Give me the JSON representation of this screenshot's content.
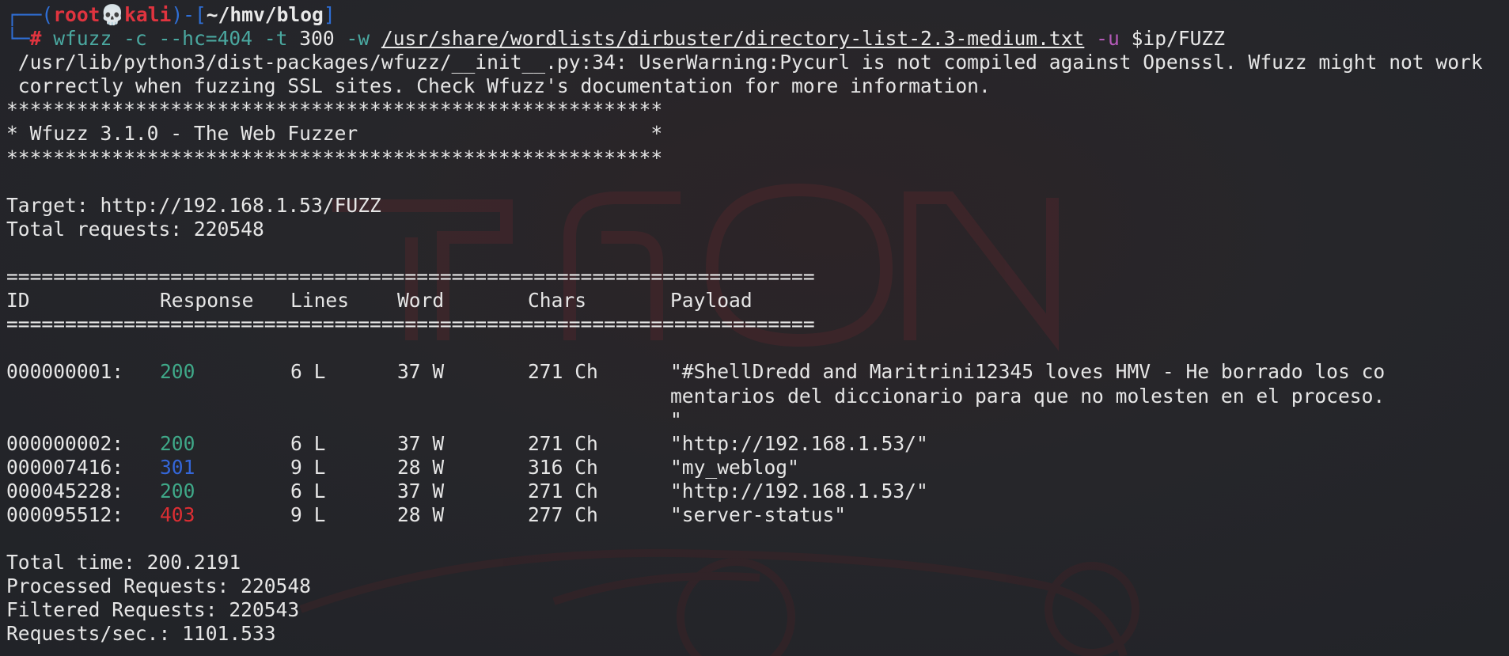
{
  "prompt": {
    "frame_top": "┌──(",
    "user": "root",
    "skull": "💀",
    "host": "kali",
    "mid": ")-[",
    "path": "~/hmv/blog",
    "end": "]",
    "frame_bottom": "└─",
    "hash": "#"
  },
  "command": {
    "program": "wfuzz",
    "flag_c": "-c",
    "flag_hc": "--hc=404",
    "flag_t": "-t",
    "threads": "300",
    "flag_w": "-w",
    "wordlist": "/usr/share/wordlists/dirbuster/directory-list-2.3-medium.txt",
    "flag_u": "-u",
    "url": "$ip/FUZZ"
  },
  "warning": {
    "line1": " /usr/lib/python3/dist-packages/wfuzz/__init__.py:34: UserWarning:Pycurl is not compiled against Openssl. Wfuzz might not work",
    "line2": " correctly when fuzzing SSL sites. Check Wfuzz's documentation for more information."
  },
  "banner": {
    "stars": "********************************************************",
    "title": "* Wfuzz 3.1.0 - The Web Fuzzer                         *"
  },
  "info": {
    "target": "Target: http://192.168.1.53/FUZZ",
    "total": "Total requests: 220548"
  },
  "table": {
    "rule": "=====================================================================",
    "headers": {
      "id": "ID",
      "response": "Response",
      "lines": "Lines",
      "word": "Word",
      "chars": "Chars",
      "payload": "Payload"
    },
    "rows": [
      {
        "id": "000000001:",
        "response": "200",
        "lines": "6 L",
        "word": "37 W",
        "chars": "271 Ch",
        "payload": "\"#ShellDredd and Maritrini12345 loves HMV - He borrado los co",
        "payload_cont1": "mentarios del diccionario para que no molesten en el proceso.",
        "payload_cont2": "\""
      },
      {
        "id": "000000002:",
        "response": "200",
        "lines": "6 L",
        "word": "37 W",
        "chars": "271 Ch",
        "payload": "\"http://192.168.1.53/\""
      },
      {
        "id": "000007416:",
        "response": "301",
        "lines": "9 L",
        "word": "28 W",
        "chars": "316 Ch",
        "payload": "\"my_weblog\""
      },
      {
        "id": "000045228:",
        "response": "200",
        "lines": "6 L",
        "word": "37 W",
        "chars": "271 Ch",
        "payload": "\"http://192.168.1.53/\""
      },
      {
        "id": "000095512:",
        "response": "403",
        "lines": "9 L",
        "word": "28 W",
        "chars": "277 Ch",
        "payload": "\"server-status\""
      }
    ]
  },
  "summary": {
    "time": "Total time: 200.2191",
    "processed": "Processed Requests: 220548",
    "filtered": "Filtered Requests: 220543",
    "rate": "Requests/sec.: 1101.533"
  },
  "colors": {
    "background": "#232529",
    "frame": "#2f6fd6",
    "user_host": "#e0343f",
    "status_200": "#3fa888",
    "status_301": "#3466d8",
    "status_403": "#dd2e33",
    "command": "#4aa8a0",
    "flag_u": "#b45ab8"
  }
}
